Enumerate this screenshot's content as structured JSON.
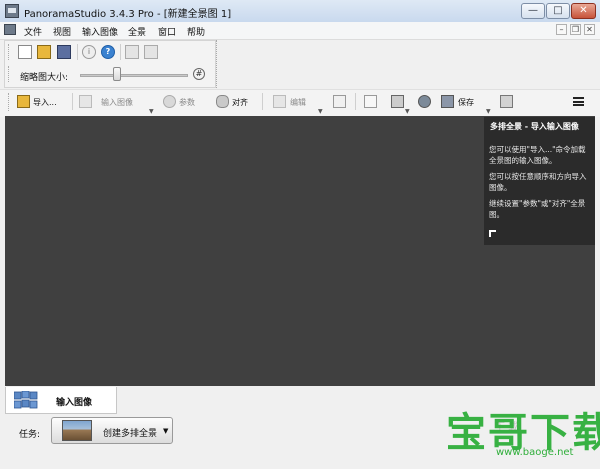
{
  "window": {
    "title": "PanoramaStudio 3.4.3 Pro - [新建全景图 1]",
    "min_glyph": "—",
    "max_glyph": "□",
    "close_glyph": "✕"
  },
  "menu": {
    "items": [
      "文件",
      "视图",
      "输入图像",
      "全景",
      "窗口",
      "帮助"
    ],
    "mdi_min": "–",
    "mdi_restore": "❐",
    "mdi_close": "✕"
  },
  "quick_panel": {
    "thumb_size_label": "缩略图大小:",
    "hash_glyph": "#",
    "slider_level_fraction": 0.33
  },
  "toolbar": {
    "import_label": "导入...",
    "input_image_label": "输入图像",
    "params_label": "参数",
    "align_label": "对齐",
    "edit_label": "编辑",
    "save_label": "保存"
  },
  "help_panel": {
    "title": "多排全景 - 导入输入图像",
    "p1": "您可以使用\"导入...\"命令加载全景图的输入图像。",
    "p2": "您可以按任意顺序和方向导入图像。",
    "p3": "继续设置\"参数\"或\"对齐\"全景图。"
  },
  "bottom": {
    "tab_label": "输入图像",
    "task_label": "任务:",
    "task_button_label": "创建多排全景"
  },
  "watermark": {
    "main": "宝哥下载",
    "faint": "下  载",
    "url": "www.baoge.net"
  },
  "colors": {
    "canvas": "#404040",
    "help_bg": "#2b2b2b",
    "watermark": "#2fae3a"
  }
}
